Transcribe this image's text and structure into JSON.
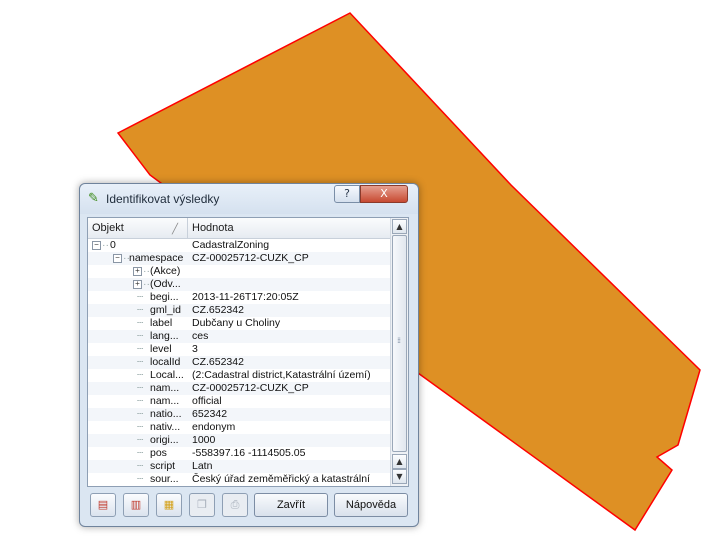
{
  "map": {
    "fill": "#de9024",
    "stroke": "#ff0000"
  },
  "dialog": {
    "title": "Identifikovat výsledky",
    "help_label": "?",
    "close_label": "X"
  },
  "table": {
    "headers": {
      "feature": "Objekt",
      "value": "Hodnota"
    },
    "rows": [
      {
        "name": "0",
        "value": "CadastralZoning"
      },
      {
        "name": "namespace",
        "value": "CZ-00025712-CUZK_CP"
      },
      {
        "name": "(Akce)",
        "value": ""
      },
      {
        "name": "(Odv...",
        "value": ""
      },
      {
        "name": "begi...",
        "value": "2013-11-26T17:20:05Z"
      },
      {
        "name": "gml_id",
        "value": "CZ.652342"
      },
      {
        "name": "label",
        "value": "Dubčany u Choliny"
      },
      {
        "name": "lang...",
        "value": "ces"
      },
      {
        "name": "level",
        "value": "3"
      },
      {
        "name": "localId",
        "value": "CZ.652342"
      },
      {
        "name": "Local...",
        "value": "(2:Cadastral district,Katastrální území)"
      },
      {
        "name": "nam...",
        "value": "CZ-00025712-CUZK_CP"
      },
      {
        "name": "nam...",
        "value": "official"
      },
      {
        "name": "natio...",
        "value": "652342"
      },
      {
        "name": "nativ...",
        "value": "endonym"
      },
      {
        "name": "origi...",
        "value": "1000"
      },
      {
        "name": "pos",
        "value": "-558397.16 -1114505.05"
      },
      {
        "name": "script",
        "value": "Latn"
      },
      {
        "name": "sour...",
        "value": "Český úřad zeměměřický a katastrální"
      }
    ]
  },
  "buttons": {
    "close": "Zavřít",
    "help": "Nápověda"
  }
}
